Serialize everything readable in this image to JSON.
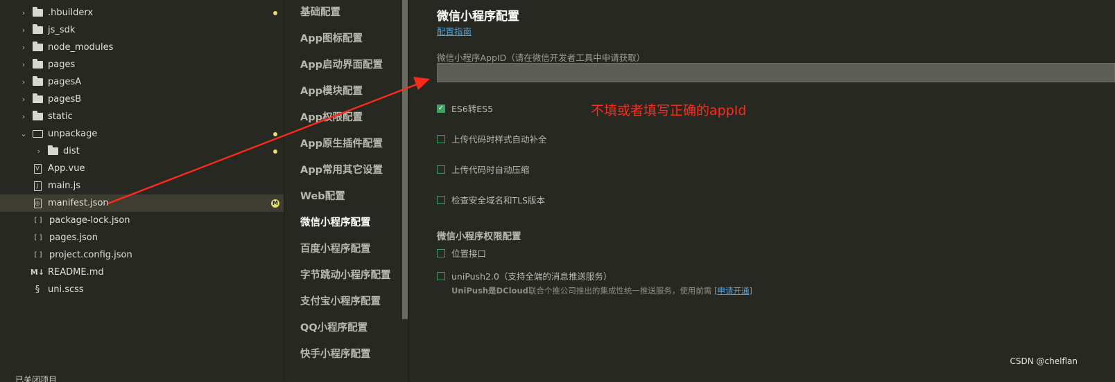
{
  "file_tree": [
    {
      "name": ".hbuilderx",
      "kind": "folder",
      "expanded": false,
      "indent": 0,
      "marker": "dot"
    },
    {
      "name": "js_sdk",
      "kind": "folder",
      "expanded": false,
      "indent": 0
    },
    {
      "name": "node_modules",
      "kind": "folder",
      "expanded": false,
      "indent": 0
    },
    {
      "name": "pages",
      "kind": "folder",
      "expanded": false,
      "indent": 0
    },
    {
      "name": "pagesA",
      "kind": "folder",
      "expanded": false,
      "indent": 0
    },
    {
      "name": "pagesB",
      "kind": "folder",
      "expanded": false,
      "indent": 0
    },
    {
      "name": "static",
      "kind": "folder",
      "expanded": false,
      "indent": 0
    },
    {
      "name": "unpackage",
      "kind": "folder-open",
      "expanded": true,
      "indent": 0,
      "marker": "dot"
    },
    {
      "name": "dist",
      "kind": "folder",
      "expanded": false,
      "indent": 1,
      "marker": "dot"
    },
    {
      "name": "App.vue",
      "kind": "file-vue",
      "indent": 0
    },
    {
      "name": "main.js",
      "kind": "file-js",
      "indent": 0
    },
    {
      "name": "manifest.json",
      "kind": "file-manifest",
      "indent": 0,
      "selected": true,
      "marker": "M"
    },
    {
      "name": "package-lock.json",
      "kind": "file-json",
      "indent": 0
    },
    {
      "name": "pages.json",
      "kind": "file-json",
      "indent": 0
    },
    {
      "name": "project.config.json",
      "kind": "file-json",
      "indent": 0
    },
    {
      "name": "README.md",
      "kind": "file-md",
      "indent": 0
    },
    {
      "name": "uni.scss",
      "kind": "file-scss",
      "indent": 0
    }
  ],
  "tree_footer": "已关闭项目",
  "nav": {
    "items": [
      "基础配置",
      "App图标配置",
      "App启动界面配置",
      "App模块配置",
      "App权限配置",
      "App原生插件配置",
      "App常用其它设置",
      "Web配置",
      "微信小程序配置",
      "百度小程序配置",
      "字节跳动小程序配置",
      "支付宝小程序配置",
      "QQ小程序配置",
      "快手小程序配置"
    ],
    "active": "微信小程序配置"
  },
  "main": {
    "title": "微信小程序配置",
    "guide_link": "配置指南",
    "appid_label": "微信小程序AppID（请在微信开发者工具中申请获取）",
    "appid_value": "",
    "options": [
      {
        "label": "ES6转ES5",
        "checked": true
      },
      {
        "label": "上传代码时样式自动补全",
        "checked": false
      },
      {
        "label": "上传代码时自动压缩",
        "checked": false
      },
      {
        "label": "检查安全域名和TLS版本",
        "checked": false
      }
    ],
    "permissions_title": "微信小程序权限配置",
    "permissions": [
      {
        "label": "位置接口",
        "checked": false
      },
      {
        "label": "uniPush2.0（支持全端的消息推送服务）",
        "checked": false
      }
    ],
    "unipush_desc_bold": "UniPush是DCloud",
    "unipush_desc_rest": "联合个推公司推出的集成性统一推送服务，使用前需",
    "unipush_apply": "[申请开通]"
  },
  "annotation": "不填或者填写正确的appId",
  "watermark": "CSDN @chelflan",
  "colors": {
    "background": "#272822",
    "selected_row": "#3e3d32",
    "accent_green": "#3ea361",
    "link_blue": "#4aa3df",
    "annotation_red": "#ff2a1a",
    "marker_yellow": "#e6db74"
  }
}
